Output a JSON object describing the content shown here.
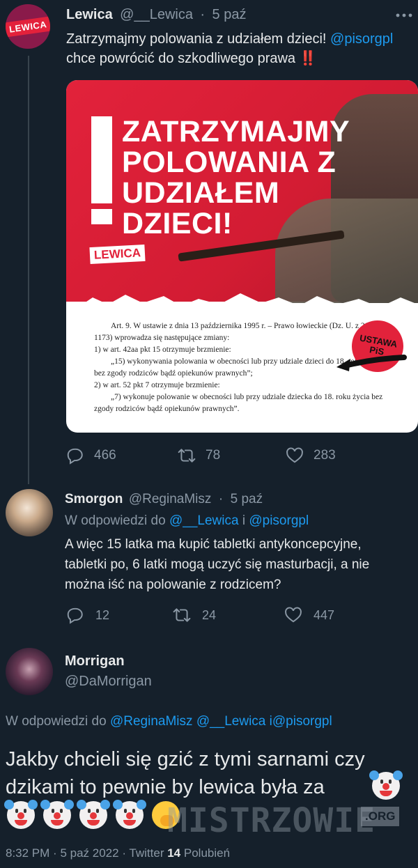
{
  "tweet1": {
    "name": "Lewica",
    "handle": "@__Lewica",
    "sep": "·",
    "time": "5 paź",
    "more_icon": "more-horizontal-icon",
    "avatar_text": "LEWICA",
    "text_line1": "Zatrzymajmy polowania z udziałem dzieci!",
    "mention": "@pisorgpl",
    "text_line2": "chce powrócić do szkodliwego prawa",
    "emoji_text": "‼️",
    "image": {
      "headline": "ZATRZYMAJMY POLOWANIA Z UDZIAŁEM DZIECI!",
      "logo_text": "LEWICA",
      "stamp_line1": "USTAWA",
      "stamp_line2": "PiS",
      "doc_lines": [
        "Art. 9. W ustawie z dnia 13 października 1995 r. – Prawo łowieckie (Dz. U. z 2022 r.",
        "1173) wprowadza się następujące zmiany:",
        "1)      w art. 42aa pkt 15 otrzymuje brzmienie:",
        "„15) wykonywania polowania w obecności lub przy udziale dzieci do 18. roku życia",
        "bez zgody rodziców bądź opiekunów prawnych”;",
        "2)      w art. 52 pkt 7 otrzymuje brzmienie:",
        "„7) wykonuje polowanie w obecności lub przy udziale dziecka do 18. roku życia bez",
        "zgody rodziców bądź opiekunów prawnych”."
      ]
    },
    "replies": "466",
    "retweets": "78",
    "likes": "283"
  },
  "tweet2": {
    "name": "Smorgon",
    "handle": "@ReginaMisz",
    "sep": "·",
    "time": "5 paź",
    "reply_prefix": "W odpowiedzi do",
    "reply_to1": "@__Lewica",
    "reply_and": "i",
    "reply_to2": "@pisorgpl",
    "lines": [
      "A więc 15 latka ma kupić tabletki antykoncepcyjne,",
      "tabletki po, 6 latki mogą uczyć się masturbacji, a nie",
      "można iść na polowanie z rodzicem?"
    ],
    "replies": "12",
    "retweets": "24",
    "likes": "447"
  },
  "tweet3": {
    "name": "Morrigan",
    "handle": "@DaMorrigan",
    "reply_prefix": "W odpowiedzi do",
    "reply_to1": "@ReginaMisz",
    "reply_to2": "@__Lewica",
    "reply_to3": "i@pisorgpl",
    "line1": "Jakby chcieli się gzić z tymi sarnami czy",
    "line2": "dzikami to pewnie by lewica była za",
    "emojis": [
      "clown-face",
      "clown-face",
      "clown-face",
      "clown-face",
      "clown-face",
      "face-with-hand-over-mouth"
    ],
    "footer_time": "8:32 PM",
    "footer_sep1": "·",
    "footer_date": "5 paź 2022",
    "footer_sep2": "·",
    "footer_source": "Twitter",
    "footer_likes_count": "14",
    "footer_likes_label": "Polubień"
  },
  "watermark": {
    "text": "MISTRZOWIE",
    "suffix": ".ORG"
  },
  "colors": {
    "background": "#15202b",
    "accent": "#1d9bf0",
    "muted": "#8b98a5",
    "brand_red": "#e2223b"
  }
}
